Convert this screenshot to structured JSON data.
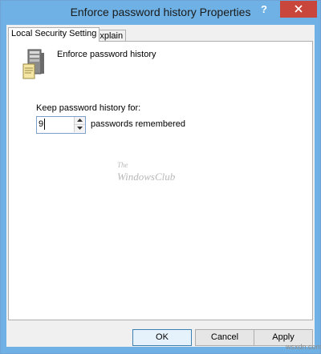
{
  "window": {
    "title": "Enforce password history Properties",
    "help_glyph": "?",
    "titlebar_color": "#6fb1e4",
    "close_color": "#c9463d"
  },
  "tabs": [
    {
      "label": "Local Security Setting",
      "active": true
    },
    {
      "label": "Explain",
      "active": false
    }
  ],
  "policy": {
    "title": "Enforce password history",
    "icon": "server-policy-icon"
  },
  "setting": {
    "label": "Keep password history for:",
    "value": "9",
    "suffix": "passwords remembered"
  },
  "watermark": {
    "line1": "The",
    "line2": "WindowsClub"
  },
  "buttons": {
    "ok": "OK",
    "cancel": "Cancel",
    "apply": "Apply"
  },
  "site_mark": "wsxdn.com"
}
